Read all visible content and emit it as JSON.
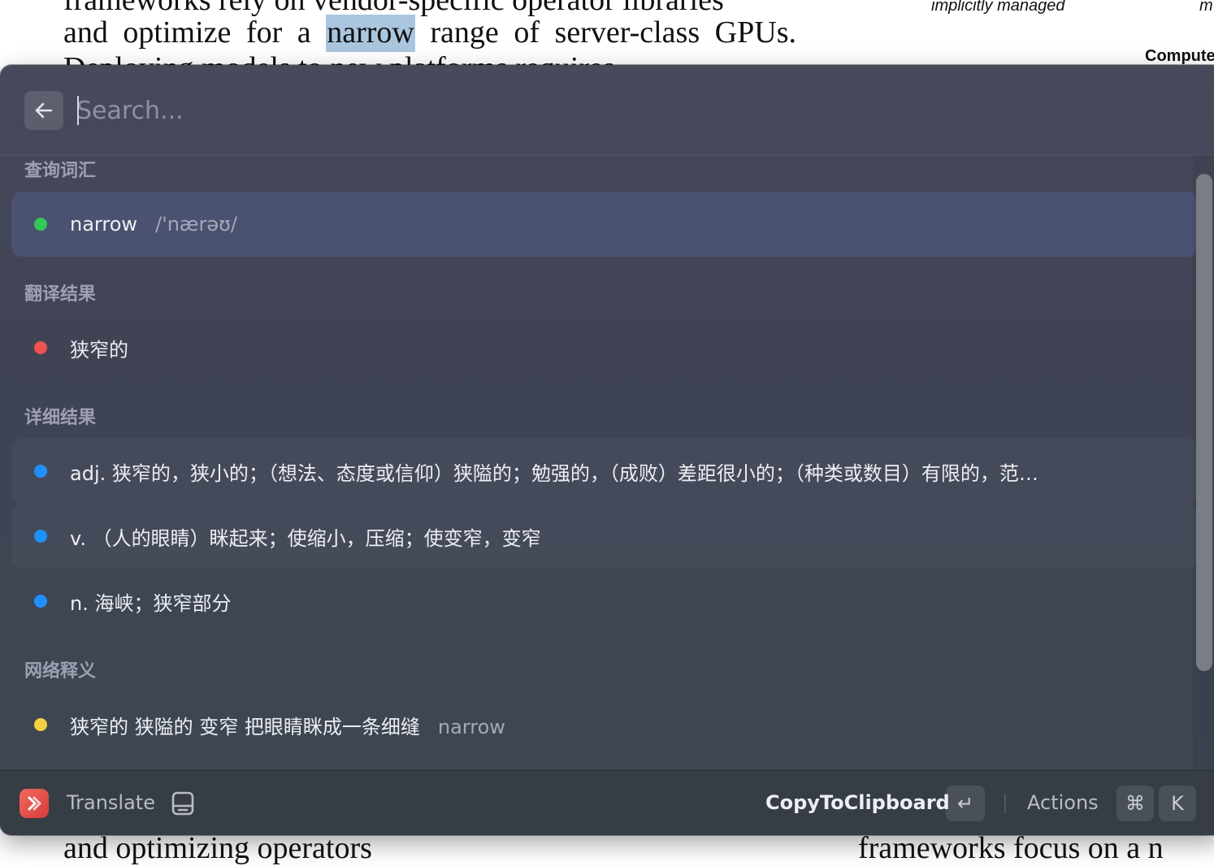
{
  "background_doc": {
    "line1": "frameworks rely on vendor-specific operator libraries",
    "line2_before": [
      "and",
      "optimize",
      "for",
      "a"
    ],
    "line2_highlight": "narrow",
    "line2_after": [
      "range",
      "of",
      "server-class",
      "GPUs."
    ],
    "line3": "Deploying models to new platforms requires",
    "side_italic": "implicitly managed",
    "side_m": "m",
    "side_bold": "Compute",
    "bottom_left": "and optimizing operators",
    "bottom_right": "frameworks focus on a n"
  },
  "search": {
    "placeholder": "Search...",
    "value": ""
  },
  "sections": {
    "lookup": "查询词汇",
    "translation": "翻译结果",
    "details": "详细结果",
    "web": "网络释义"
  },
  "rows": {
    "word": {
      "text": "narrow",
      "phonetic": "/'nærəʊ/",
      "dot_color": "#34c759"
    },
    "translation": {
      "text": "狭窄的",
      "dot_color": "#ef5350"
    },
    "detail_adj": {
      "text": "adj. 狭窄的，狭小的；（想法、态度或信仰）狭隘的；勉强的，（成败）差距很小的；（种类或数目）有限的，范…",
      "dot_color": "#1e90ff"
    },
    "detail_v": {
      "text": "v. （人的眼睛）眯起来；使缩小，压缩；使变窄，变窄",
      "dot_color": "#1e90ff"
    },
    "detail_n": {
      "text": "n. 海峡；狭窄部分",
      "dot_color": "#1e90ff"
    },
    "web": {
      "text": "狭窄的 狭隘的 变窄 把眼睛眯成一条细缝",
      "sub": "narrow",
      "dot_color": "#f5d142"
    }
  },
  "footer": {
    "title": "Translate",
    "primary_action": "CopyToClipboard",
    "enter_key": "↵",
    "actions_label": "Actions",
    "cmd_key": "⌘",
    "k_key": "K"
  }
}
